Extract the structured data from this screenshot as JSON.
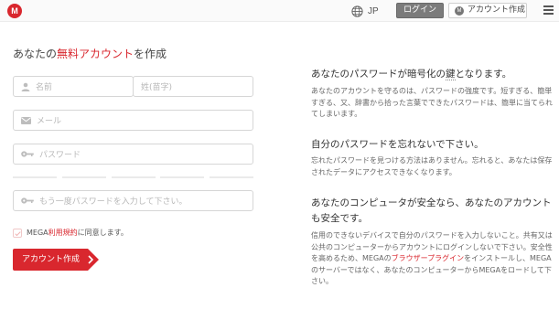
{
  "header": {
    "logo_letter": "M",
    "language": "JP",
    "login_label": "ログイン",
    "create_account_label": "アカウント作成",
    "mini_logo_letter": "M"
  },
  "form": {
    "title_prefix": "あなたの",
    "title_highlight": "無料アカウント",
    "title_suffix": "を作成",
    "lastname_placeholder": "名前",
    "firstname_placeholder": "姓(苗字)",
    "email_placeholder": "メール",
    "password_placeholder": "パスワード",
    "password_confirm_placeholder": "もう一度パスワードを入力して下さい。",
    "terms_prefix": "MEGA",
    "terms_link": "利用規約",
    "terms_suffix": "に同意します。",
    "submit_label": "アカウント作成"
  },
  "info": {
    "heading1_a": "あなたのパスワードが暗号化の",
    "heading1_b": "鍵",
    "heading1_c": "となります。",
    "para1": "あなたのアカウントを守るのは、パスワードの強度です。短すぎる、簡単すぎる、又、辞書から拾った言葉でできたパスワードは、簡単に当てられてしまいます。",
    "heading2": "自分のパスワードを忘れないで下さい。",
    "para2": "忘れたパスワードを見つける方法はありません。忘れると、あなたは保存されたデータにアクセスできなくなります。",
    "heading3": "あなたのコンピュータが安全なら、あなたのアカウントも安全です。",
    "para3_a": "信用のできないデバイスで自分のパスワードを入力しないこと。共有又は公共のコンピューターからアカウントにログインしないで下さい。安全性を高めるため、MEGAの",
    "para3_link": "ブラウザープラグイン",
    "para3_b": "をインストールし、MEGAのサーバーではなく、あなたのコンピューターからMEGAをロードして下さい。"
  },
  "colors": {
    "accent": "#d9272e",
    "login_button": "#7b7b7b"
  },
  "icons": [
    "mega-logo-icon",
    "globe-icon",
    "menu-icon",
    "user-icon",
    "mail-icon",
    "key-icon",
    "checkbox-icon",
    "chevron-right-icon"
  ]
}
